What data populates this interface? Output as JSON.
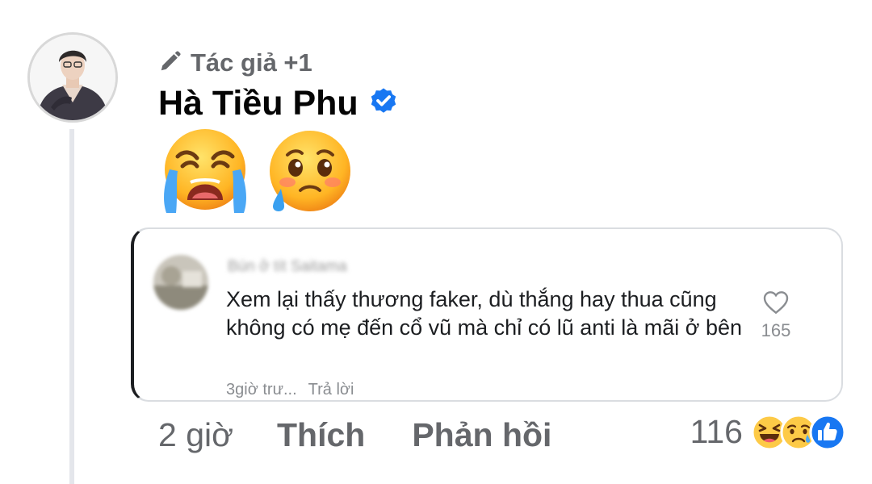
{
  "comment": {
    "badge": {
      "icon": "pencil-icon",
      "text": "Tác giả +1"
    },
    "author": {
      "name": "Hà Tiều Phu",
      "verified_icon": "verified-badge-icon"
    },
    "emojis": [
      "loudly-crying-face",
      "face-holding-back-tears"
    ],
    "quoted_comment": {
      "author": "Bún ở tít Saitama",
      "text": "Xem lại thấy thương faker, dù thắng hay thua cũng không có mẹ đến cổ vũ mà chỉ có lũ anti là mãi ở bên",
      "like_count": "165",
      "time": "3giờ trư...",
      "reply_label": "Trả lời"
    },
    "actions": {
      "time": "2 giờ",
      "like_label": "Thích",
      "reply_label": "Phản hồi"
    },
    "reactions": {
      "count": "116",
      "icons": [
        "laughing-face-icon",
        "sad-face-icon",
        "like-thumb-icon"
      ]
    }
  },
  "colors": {
    "text_primary": "#050505",
    "text_secondary": "#65676b",
    "verified_blue": "#1877f2",
    "like_blue": "#1877f2",
    "card_border": "#dadde1"
  }
}
